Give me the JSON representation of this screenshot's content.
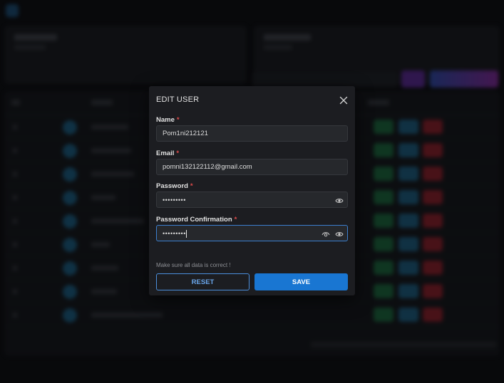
{
  "modal": {
    "title": "EDIT USER",
    "fields": {
      "name": {
        "label": "Name",
        "value": "Pom1ni212121"
      },
      "email": {
        "label": "Email",
        "value": "pomni132122112@gmail.com"
      },
      "password": {
        "label": "Password",
        "value": "•••••••••"
      },
      "password_confirmation": {
        "label": "Password Confirmation",
        "value": "•••••••••"
      }
    },
    "required_marker": "*",
    "hint": "Make sure all data is correct !",
    "reset_label": "RESET",
    "save_label": "SAVE"
  },
  "colors": {
    "accent": "#1976d2",
    "required": "#e04b4b",
    "modal_bg": "#1c1d21",
    "page_bg": "#0b0c0f"
  },
  "icons": {
    "close": "close-icon",
    "eye": "eye-icon",
    "eye_open": "eye-open-icon"
  }
}
